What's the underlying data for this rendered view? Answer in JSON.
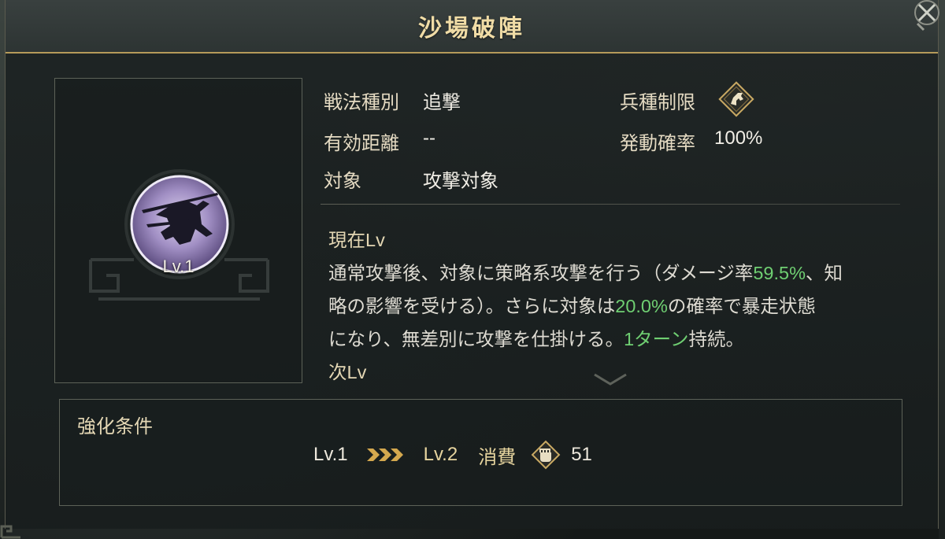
{
  "title": "沙場破陣",
  "skill": {
    "level_label": "Lv.1"
  },
  "info": {
    "type_label": "戦法種別",
    "type_value": "追撃",
    "range_label": "有効距離",
    "range_value": "--",
    "target_label": "対象",
    "target_value": "攻撃対象",
    "unit_label": "兵種制限",
    "unit_icon": "horse-cavalry-icon",
    "rate_label": "発動確率",
    "rate_value": "100%"
  },
  "description": {
    "current_heading": "現在Lv",
    "line1_a": "通常攻撃後、対象に策略系攻撃を行う（ダメージ率",
    "line1_hl": "59.5%",
    "line1_b": "、知",
    "line2_a": "略の影響を受ける）。さらに対象は",
    "line2_hl": "20.0%",
    "line2_b": "の確率で暴走状態",
    "line3_a": "になり、無差別に攻撃を仕掛ける。",
    "line3_hl": "1ターン",
    "line3_b": "持続。",
    "next_heading": "次Lv"
  },
  "enhance": {
    "title": "強化条件",
    "from_level": "Lv.1",
    "to_level": "Lv.2",
    "cost_label": "消費",
    "cost_value": "51",
    "resource_icon": "fist-token-icon"
  },
  "colors": {
    "accent_gold": "#b59a5a",
    "highlight_green": "#6fcf72"
  }
}
